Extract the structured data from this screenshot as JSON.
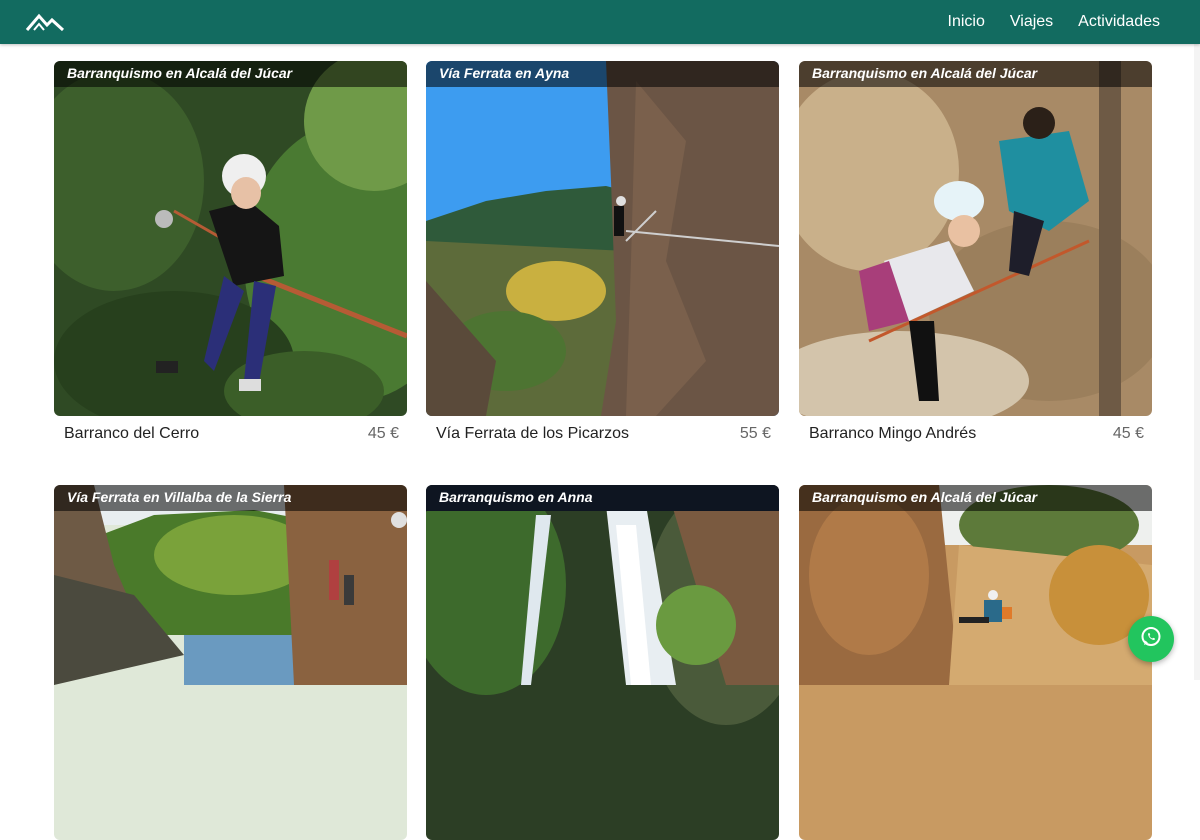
{
  "header": {
    "logo_icon": "mountain-logo-icon",
    "nav": [
      {
        "label": "Inicio"
      },
      {
        "label": "Viajes"
      },
      {
        "label": "Actividades"
      }
    ]
  },
  "colors": {
    "brand": "#126b60",
    "whatsapp": "#22c55e"
  },
  "cards": [
    {
      "badge": "Barranquismo en Alcalá del Júcar",
      "title": "Barranco del Cerro",
      "price": "45 €"
    },
    {
      "badge": "Vía Ferrata en Ayna",
      "title": "Vía Ferrata de los Picarzos",
      "price": "55 €"
    },
    {
      "badge": "Barranquismo en Alcalá del Júcar",
      "title": "Barranco Mingo Andrés",
      "price": "45 €"
    },
    {
      "badge": "Vía Ferrata en Villalba de la Sierra",
      "title": "",
      "price": ""
    },
    {
      "badge": "Barranquismo en Anna",
      "title": "",
      "price": ""
    },
    {
      "badge": "Barranquismo en Alcalá del Júcar",
      "title": "",
      "price": ""
    }
  ],
  "floating": {
    "whatsapp_icon": "whatsapp-icon"
  }
}
